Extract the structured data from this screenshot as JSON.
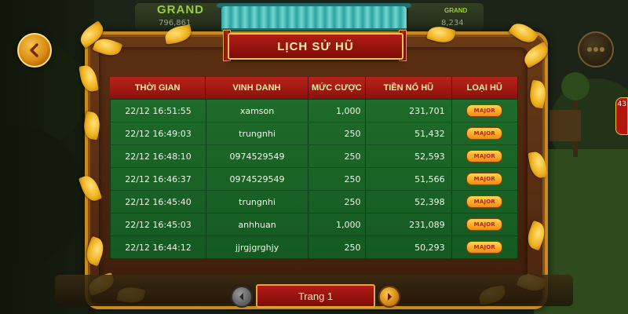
{
  "top_jackpots": {
    "left_title": "GRAND",
    "left_value": "796,861",
    "right_title": "GRAND",
    "right_value": "8,234"
  },
  "title": "LỊCH SỬ HŨ",
  "columns": [
    "THỜI GIAN",
    "VINH DANH",
    "MỨC CƯỢC",
    "TIỀN NỔ HŨ",
    "LOẠI HŨ"
  ],
  "rows": [
    {
      "time": "22/12 16:51:55",
      "name": "xamson",
      "bet": "1,000",
      "jackpot": "231,701",
      "type": "MAJOR"
    },
    {
      "time": "22/12 16:49:03",
      "name": "trungnhi",
      "bet": "250",
      "jackpot": "51,432",
      "type": "MAJOR"
    },
    {
      "time": "22/12 16:48:10",
      "name": "0974529549",
      "bet": "250",
      "jackpot": "52,593",
      "type": "MAJOR"
    },
    {
      "time": "22/12 16:46:37",
      "name": "0974529549",
      "bet": "250",
      "jackpot": "51,566",
      "type": "MAJOR"
    },
    {
      "time": "22/12 16:45:40",
      "name": "trungnhi",
      "bet": "250",
      "jackpot": "52,398",
      "type": "MAJOR"
    },
    {
      "time": "22/12 16:45:03",
      "name": "anhhuan",
      "bet": "1,000",
      "jackpot": "231,089",
      "type": "MAJOR"
    },
    {
      "time": "22/12 16:44:12",
      "name": "jjrgjgrghjy",
      "bet": "250",
      "jackpot": "50,293",
      "type": "MAJOR"
    }
  ],
  "pagination": {
    "label": "Trang 1"
  },
  "side_badge": "43",
  "colors": {
    "header_red": "#b8231a",
    "table_green": "#1e6b2a",
    "gold": "#f0c24a",
    "frame_brown": "#6a3a16"
  },
  "icons": {
    "back": "chevron-left-icon",
    "menu": "menu-dots-icon",
    "prev": "arrow-left-icon",
    "next": "arrow-right-icon"
  }
}
